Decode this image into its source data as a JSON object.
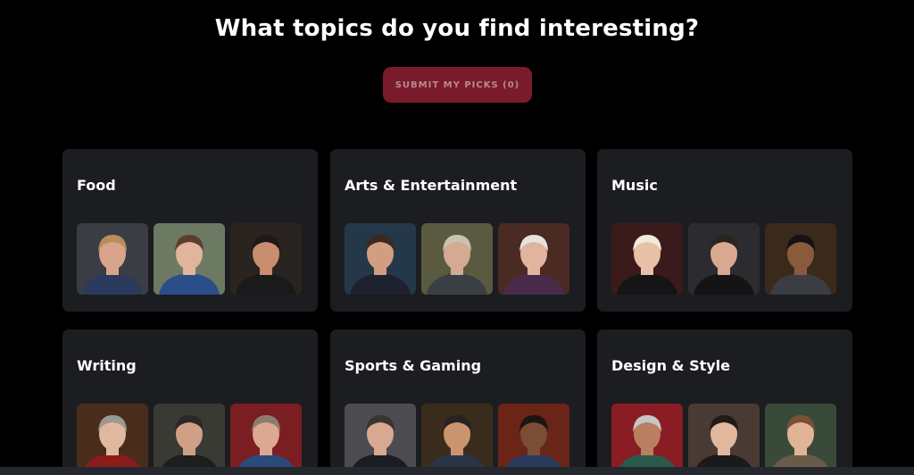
{
  "page": {
    "title": "What topics do you find interesting?",
    "submit_label": "SUBMIT MY PICKS (0)"
  },
  "colors": {
    "background": "#000000",
    "card": "#1c1d21",
    "submit_button": "#7a1b2c",
    "submit_text": "#b88a93"
  },
  "categories": [
    {
      "name": "Food",
      "photos": [
        {
          "bg": "#3a3d44",
          "skin": "#d8a58a",
          "hair": "#b98d5a",
          "shirt": "#2a3a5c"
        },
        {
          "bg": "#6c7a64",
          "skin": "#e2b49c",
          "hair": "#5b3f2c",
          "shirt": "#2b4d8a"
        },
        {
          "bg": "#2a2420",
          "skin": "#c98d70",
          "hair": "#1f1a18",
          "shirt": "#1a1a1a"
        }
      ]
    },
    {
      "name": "Arts & Entertainment",
      "photos": [
        {
          "bg": "#24384a",
          "skin": "#d29e82",
          "hair": "#3a2a22",
          "shirt": "#1e2230"
        },
        {
          "bg": "#5a5a40",
          "skin": "#d4aa92",
          "hair": "#c9c2b0",
          "shirt": "#3a3f45"
        },
        {
          "bg": "#4a2a22",
          "skin": "#e0b49e",
          "hair": "#e6e3de",
          "shirt": "#4a2a4a"
        }
      ]
    },
    {
      "name": "Music",
      "photos": [
        {
          "bg": "#3a1a1a",
          "skin": "#e8c0a8",
          "hair": "#f1ead8",
          "shirt": "#151515"
        },
        {
          "bg": "#2c2c30",
          "skin": "#d8a890",
          "hair": "#2a2420",
          "shirt": "#141414"
        },
        {
          "bg": "#3a2a1c",
          "skin": "#8a5a3c",
          "hair": "#141212",
          "shirt": "#3a3d42"
        }
      ]
    },
    {
      "name": "Writing",
      "photos": [
        {
          "bg": "#4a2c1a",
          "skin": "#e0b8a0",
          "hair": "#9a9894",
          "shirt": "#8a1c1c"
        },
        {
          "bg": "#3a3a34",
          "skin": "#d0a086",
          "hair": "#2a2826",
          "shirt": "#1e1e1e"
        },
        {
          "bg": "#7a1e22",
          "skin": "#dca890",
          "hair": "#8c7c70",
          "shirt": "#2a4a7a"
        }
      ]
    },
    {
      "name": "Sports & Gaming",
      "photos": [
        {
          "bg": "#4c4c50",
          "skin": "#d8a890",
          "hair": "#3a3430",
          "shirt": "#1c1c24"
        },
        {
          "bg": "#3a2c1c",
          "skin": "#c9946e",
          "hair": "#2a2220",
          "shirt": "#2a3648"
        },
        {
          "bg": "#6a2418",
          "skin": "#7a4e34",
          "hair": "#1a1412",
          "shirt": "#2a3a5c"
        }
      ]
    },
    {
      "name": "Design & Style",
      "photos": [
        {
          "bg": "#8a1c24",
          "skin": "#b88060",
          "hair": "#c8c6c2",
          "shirt": "#2a5a4a"
        },
        {
          "bg": "#4a3a34",
          "skin": "#e0b89e",
          "hair": "#201a18",
          "shirt": "#1a1a1a"
        },
        {
          "bg": "#3a4a3a",
          "skin": "#e2b496",
          "hair": "#7a5034",
          "shirt": "#6a5a4a"
        }
      ]
    }
  ]
}
